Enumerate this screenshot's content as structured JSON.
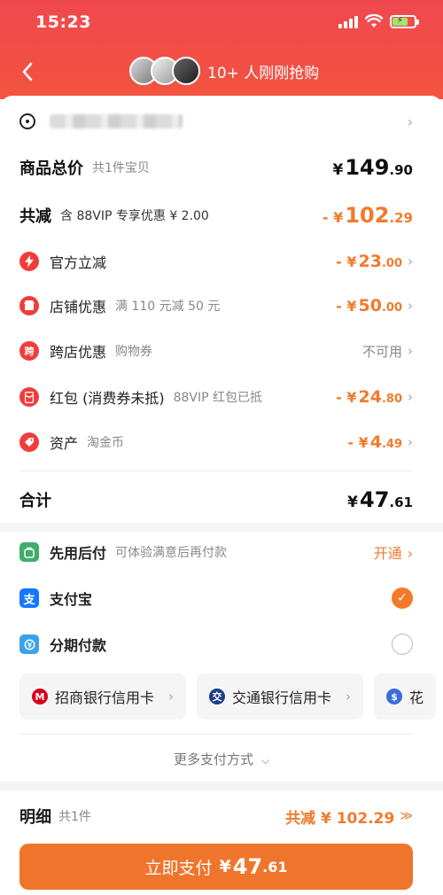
{
  "status_bar": {
    "time": "15:23"
  },
  "nav": {
    "back_icon": "chevron-left-icon",
    "title": "10+ 人刚刚抢购"
  },
  "colors": {
    "header": "#f0484f",
    "accent": "#f27a2a",
    "button": "#f0752c"
  },
  "summary": {
    "goods_total_label": "商品总价",
    "goods_total_sub": "共1件宝贝",
    "goods_total_yen": "¥",
    "goods_total_int": "149",
    "goods_total_dec": ".90",
    "reduce_label": "共减",
    "reduce_sub": "含 88VIP 专享优惠 ¥ 2.00",
    "reduce_prefix": "- ¥",
    "reduce_int": "102",
    "reduce_dec": ".29"
  },
  "discounts": [
    {
      "icon": "lightning-icon",
      "label": "官方立减",
      "sub": "",
      "prefix": "- ¥",
      "int": "23",
      "dec": ".00"
    },
    {
      "icon": "shop-icon",
      "label": "店铺优惠",
      "sub": "满 110 元减 50 元",
      "prefix": "- ¥",
      "int": "50",
      "dec": ".00"
    },
    {
      "icon": "cross-store-icon",
      "icon_text": "跨",
      "label": "跨店优惠",
      "sub": "购物券",
      "status": "不可用"
    },
    {
      "icon": "red-packet-icon",
      "label": "红包 (消费券未抵)",
      "sub": "88VIP 红包已抵",
      "prefix": "- ¥",
      "int": "24",
      "dec": ".80"
    },
    {
      "icon": "tag-icon",
      "label": "资产",
      "sub": "淘金币",
      "prefix": "- ¥",
      "int": "4",
      "dec": ".49"
    }
  ],
  "total": {
    "label": "合计",
    "yen": "¥",
    "int": "47",
    "dec": ".61"
  },
  "payment": {
    "pay_later": {
      "icon": "pay-later-icon",
      "label": "先用后付",
      "sub": "可体验满意后再付款",
      "action": "开通"
    },
    "alipay": {
      "icon": "alipay-icon",
      "icon_text": "支",
      "label": "支付宝",
      "checked": true
    },
    "installment": {
      "icon": "installment-icon",
      "label": "分期付款",
      "checked": false
    },
    "banks": [
      {
        "icon": "cmb-logo-icon",
        "name": "招商银行信用卡"
      },
      {
        "icon": "bocom-logo-icon",
        "name": "交通银行信用卡"
      },
      {
        "icon": "bank-logo-icon",
        "name": "花"
      }
    ],
    "more_label": "更多支付方式"
  },
  "detail": {
    "label": "明细",
    "sub": "共1件",
    "reduce_text": "共减 ¥ 102.29"
  },
  "pay_button": {
    "label": "立即支付",
    "yen": "¥",
    "int": "47",
    "dec": ".61"
  }
}
